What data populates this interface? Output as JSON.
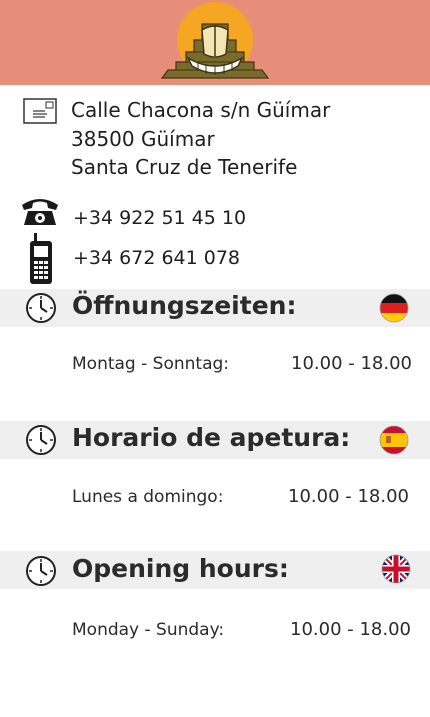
{
  "address": {
    "line1": "Calle Chacona s/n Güímar",
    "line2": "38500 Güímar",
    "line3": "Santa Cruz de Tenerife"
  },
  "phones": {
    "landline": "+34 922 51 45 10",
    "mobile": "+34 672 641 078"
  },
  "sections": [
    {
      "title": "Öffnungszeiten:",
      "flag": "flag-germany-icon",
      "days": "Montag - Sonntag:",
      "time": "10.00 - 18.00"
    },
    {
      "title": "Horario de apetura:",
      "flag": "flag-spain-icon",
      "days": "Lunes a domingo:",
      "time": "10.00 - 18.00"
    },
    {
      "title": "Opening hours:",
      "flag": "flag-uk-icon",
      "days": "Monday - Sunday:",
      "time": "10.00 - 18.00"
    }
  ],
  "colors": {
    "header": "#e68e79",
    "band": "#efefef",
    "logo_orange": "#f5a623",
    "logo_olive": "#7a6b2c"
  }
}
